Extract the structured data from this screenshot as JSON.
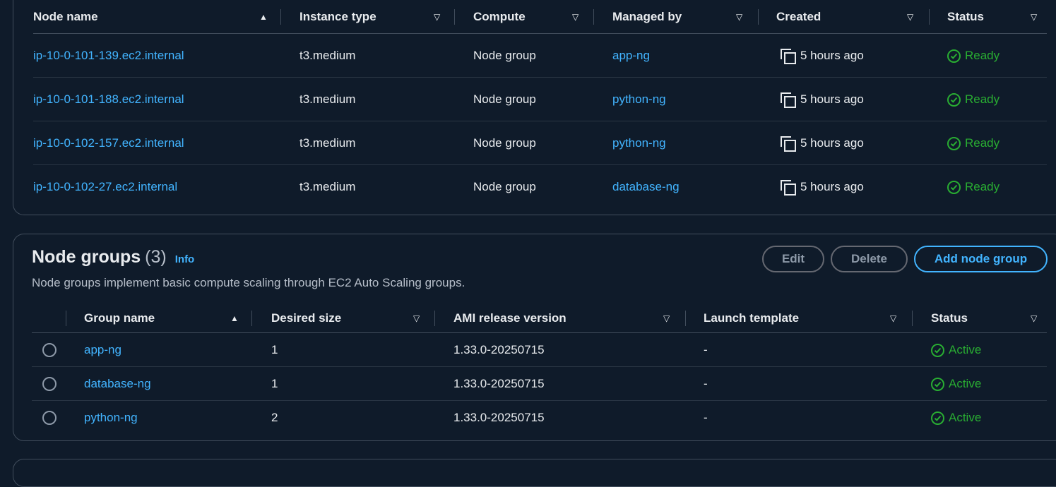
{
  "nodes": {
    "columns": [
      "Node name",
      "Instance type",
      "Compute",
      "Managed by",
      "Created",
      "Status"
    ],
    "rows": [
      {
        "name": "ip-10-0-101-139.ec2.internal",
        "instance": "t3.medium",
        "compute": "Node group",
        "managed_by": "app-ng",
        "created": "5 hours ago",
        "status": "Ready"
      },
      {
        "name": "ip-10-0-101-188.ec2.internal",
        "instance": "t3.medium",
        "compute": "Node group",
        "managed_by": "python-ng",
        "created": "5 hours ago",
        "status": "Ready"
      },
      {
        "name": "ip-10-0-102-157.ec2.internal",
        "instance": "t3.medium",
        "compute": "Node group",
        "managed_by": "python-ng",
        "created": "5 hours ago",
        "status": "Ready"
      },
      {
        "name": "ip-10-0-102-27.ec2.internal",
        "instance": "t3.medium",
        "compute": "Node group",
        "managed_by": "database-ng",
        "created": "5 hours ago",
        "status": "Ready"
      }
    ]
  },
  "node_groups": {
    "title": "Node groups",
    "count": "(3)",
    "info": "Info",
    "description": "Node groups implement basic compute scaling through EC2 Auto Scaling groups.",
    "buttons": {
      "edit": "Edit",
      "delete": "Delete",
      "add": "Add node group"
    },
    "columns": [
      "Group name",
      "Desired size",
      "AMI release version",
      "Launch template",
      "Status"
    ],
    "rows": [
      {
        "name": "app-ng",
        "desired": "1",
        "ami": "1.33.0-20250715",
        "template": "-",
        "status": "Active"
      },
      {
        "name": "database-ng",
        "desired": "1",
        "ami": "1.33.0-20250715",
        "template": "-",
        "status": "Active"
      },
      {
        "name": "python-ng",
        "desired": "2",
        "ami": "1.33.0-20250715",
        "template": "-",
        "status": "Active"
      }
    ]
  },
  "colors": {
    "background": "#0f1b2a",
    "link": "#42b4ff",
    "success": "#29ad32",
    "border": "#414d5c"
  },
  "icons": {
    "copy": "copy-icon",
    "status_ok": "check-circle-icon",
    "sort_asc": "sort-ascending-icon",
    "sort": "sort-icon"
  }
}
